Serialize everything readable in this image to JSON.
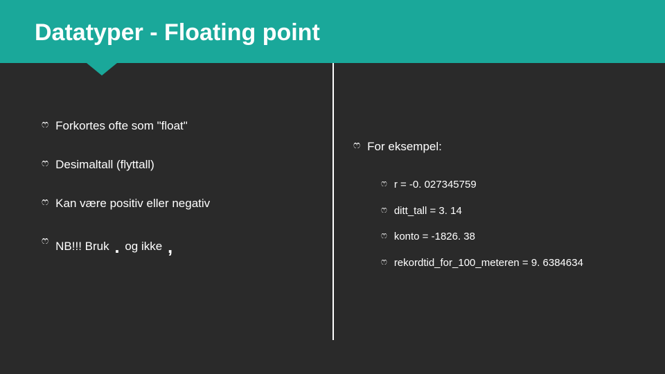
{
  "title": "Datatyper - Floating point",
  "left": {
    "items": [
      "Forkortes ofte som \"float\"",
      "Desimaltall (flyttall)",
      "Kan være positiv eller negativ"
    ],
    "nb_prefix": "NB!!! Bruk",
    "nb_dot": ".",
    "nb_mid": "og ikke",
    "nb_comma": ","
  },
  "right": {
    "heading": "For eksempel:",
    "examples": [
      "r = -0. 027345759",
      "ditt_tall = 3. 14",
      "konto = -1826. 38",
      "rekordtid_for_100_meteren = 9. 6384634"
    ]
  },
  "bullet_glyph": "ෆ"
}
